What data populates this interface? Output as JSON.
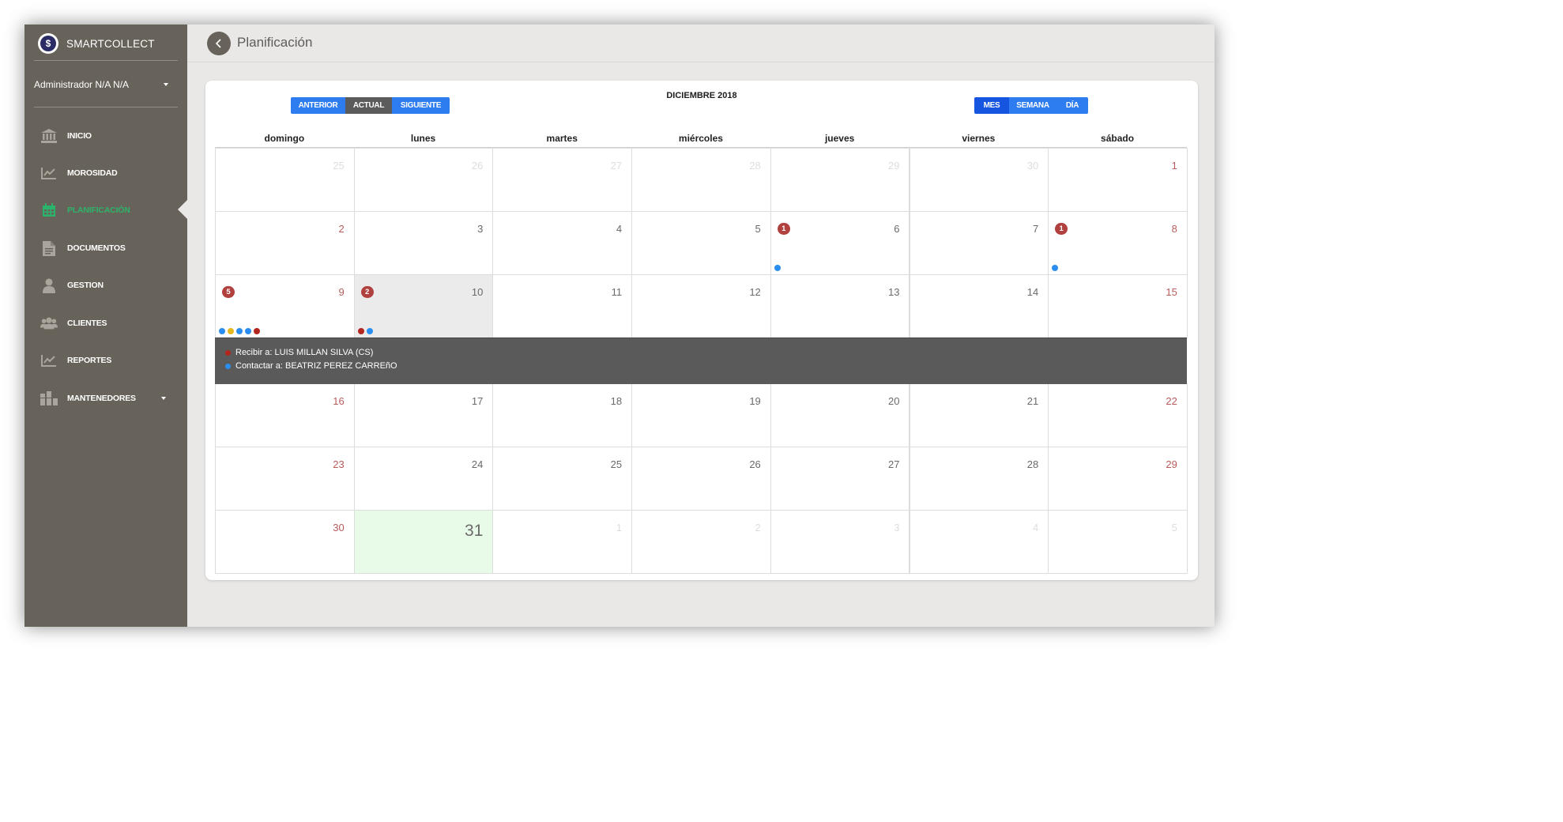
{
  "app": {
    "name": "SMARTCOLLECT",
    "logo_glyph": "$"
  },
  "user": {
    "name": "Administrador N/A N/A"
  },
  "nav": [
    {
      "label": "INICIO",
      "icon": "bank-icon",
      "active": false
    },
    {
      "label": "MOROSIDAD",
      "icon": "chart-line-icon",
      "active": false
    },
    {
      "label": "PLANIFICACIÓN",
      "icon": "calendar-icon",
      "active": true
    },
    {
      "label": "DOCUMENTOS",
      "icon": "document-icon",
      "active": false
    },
    {
      "label": "GESTION",
      "icon": "user-icon",
      "active": false
    },
    {
      "label": "CLIENTES",
      "icon": "users-icon",
      "active": false
    },
    {
      "label": "REPORTES",
      "icon": "chart-line-icon",
      "active": false
    },
    {
      "label": "MANTENEDORES",
      "icon": "boxes-icon",
      "active": false,
      "has_dropdown": true
    }
  ],
  "page": {
    "title": "Planificación"
  },
  "calendar": {
    "month_title": "DICIEMBRE 2018",
    "nav_buttons": [
      {
        "label": "ANTERIOR",
        "active": false
      },
      {
        "label": "ACTUAL",
        "active": true
      },
      {
        "label": "SIGUIENTE",
        "active": false
      }
    ],
    "view_buttons": [
      {
        "label": "MES",
        "active": true
      },
      {
        "label": "SEMANA",
        "active": false
      },
      {
        "label": "DÍA",
        "active": false
      }
    ],
    "weekdays": [
      "domingo",
      "lunes",
      "martes",
      "miércoles",
      "jueves",
      "viernes",
      "sábado"
    ],
    "weeks": [
      [
        {
          "day": "25",
          "other": true
        },
        {
          "day": "26",
          "other": true
        },
        {
          "day": "27",
          "other": true
        },
        {
          "day": "28",
          "other": true
        },
        {
          "day": "29",
          "other": true
        },
        {
          "day": "30",
          "other": true
        },
        {
          "day": "1"
        }
      ],
      [
        {
          "day": "2"
        },
        {
          "day": "3"
        },
        {
          "day": "4"
        },
        {
          "day": "5"
        },
        {
          "day": "6",
          "badge": "1",
          "dots": [
            "#2a8ef0"
          ]
        },
        {
          "day": "7"
        },
        {
          "day": "8",
          "badge": "1",
          "dots": [
            "#2a8ef0"
          ]
        }
      ],
      [
        {
          "day": "9",
          "badge": "5",
          "dots": [
            "#2a8ef0",
            "#e6b820",
            "#2a8ef0",
            "#2a8ef0",
            "#b3261e"
          ]
        },
        {
          "day": "10",
          "badge": "2",
          "dots": [
            "#b3261e",
            "#2a8ef0"
          ],
          "selected": true
        },
        {
          "day": "11"
        },
        {
          "day": "12"
        },
        {
          "day": "13"
        },
        {
          "day": "14"
        },
        {
          "day": "15"
        }
      ],
      [
        {
          "day": "16"
        },
        {
          "day": "17"
        },
        {
          "day": "18"
        },
        {
          "day": "19"
        },
        {
          "day": "20"
        },
        {
          "day": "21"
        },
        {
          "day": "22"
        }
      ],
      [
        {
          "day": "23"
        },
        {
          "day": "24"
        },
        {
          "day": "25"
        },
        {
          "day": "26"
        },
        {
          "day": "27"
        },
        {
          "day": "28"
        },
        {
          "day": "29"
        }
      ],
      [
        {
          "day": "30"
        },
        {
          "day": "31",
          "today": true
        },
        {
          "day": "1",
          "other": true
        },
        {
          "day": "2",
          "other": true
        },
        {
          "day": "3",
          "other": true
        },
        {
          "day": "4",
          "other": true
        },
        {
          "day": "5",
          "other": true
        }
      ]
    ],
    "events": [
      {
        "color": "#b3261e",
        "text": "Recibir a: LUIS MILLAN SILVA (CS)"
      },
      {
        "color": "#2a8ef0",
        "text": "Contactar a: BEATRIZ PEREZ CARREñO"
      }
    ]
  },
  "colors": {
    "sidebar_bg": "#68635a",
    "active_nav": "#2cb36b",
    "button_blue": "#2d7cf0",
    "button_active": "#5b5b5b",
    "view_active": "#1555e0",
    "badge_red": "#b1413f",
    "weekend_red": "#b95b5b",
    "today_bg": "#e8fbe8",
    "selected_bg": "#ebebeb",
    "events_bg": "#5a5a5a"
  }
}
